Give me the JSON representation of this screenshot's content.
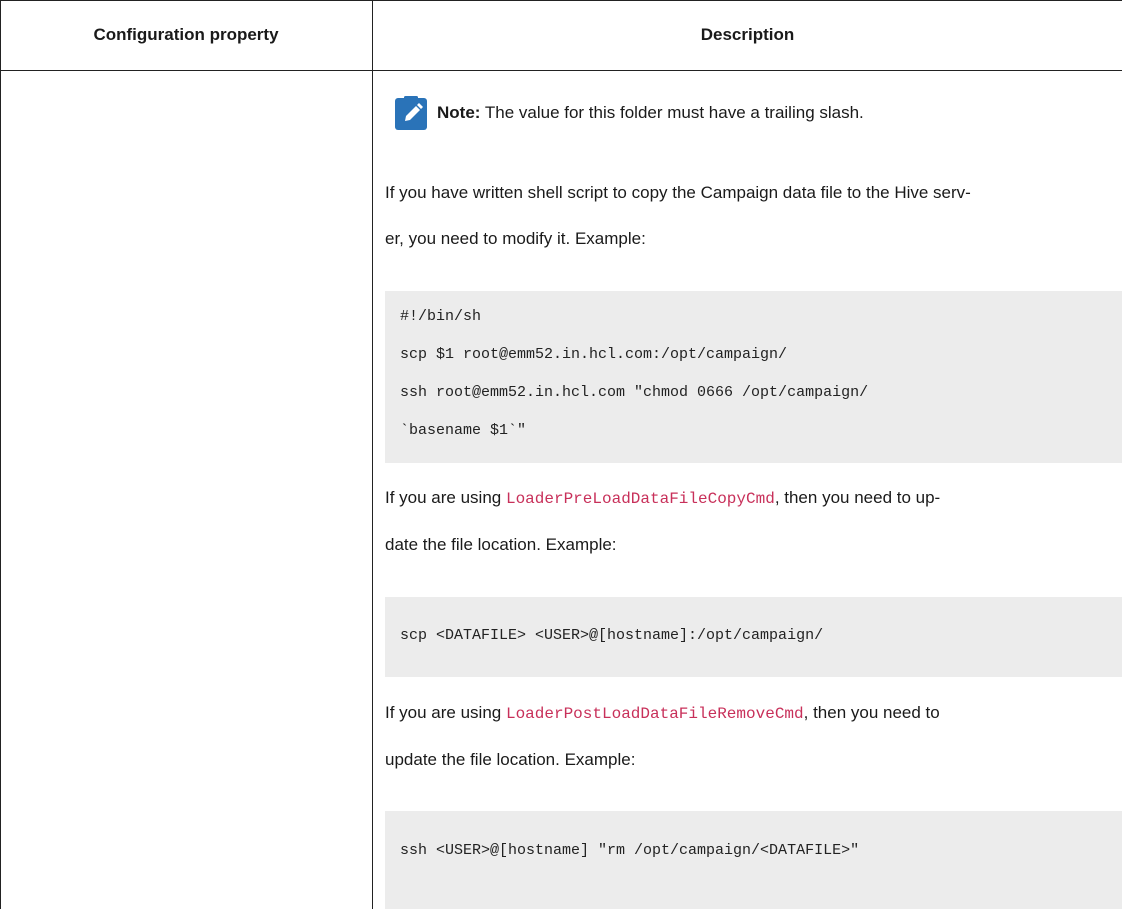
{
  "table": {
    "header": {
      "col1": "Configuration property",
      "col2": "Description"
    }
  },
  "note": {
    "icon": "pencil-note-icon",
    "label": "Note:",
    "text": " The value for this folder must have a trailing slash."
  },
  "paragraphs": {
    "p1_line1": "If you have written shell script to copy the Campaign data file to the Hive serv-",
    "p1_line2": "er, you need to modify it. Example:",
    "p2_pre": "If you are using ",
    "p2_code": "LoaderPreLoadDataFileCopyCmd",
    "p2_post": ", then you need to up-",
    "p2_line2": "date the file location. Example:",
    "p3_pre": "If you are using ",
    "p3_code": "LoaderPostLoadDataFileRemoveCmd",
    "p3_post": ", then you need to",
    "p3_line2": "update the file location. Example:"
  },
  "code_blocks": {
    "block1": [
      "#!/bin/sh",
      "scp $1 root@emm52.in.hcl.com:/opt/campaign/",
      "ssh root@emm52.in.hcl.com \"chmod 0666 /opt/campaign/",
      "`basename $1`\""
    ],
    "block2": [
      "scp <DATAFILE> <USER>@[hostname]:/opt/campaign/"
    ],
    "block3": [
      "ssh <USER>@[hostname] \"rm /opt/campaign/<DATAFILE>\""
    ]
  },
  "colors": {
    "code_link": "#c8305a",
    "code_bg": "#ececec",
    "note_icon": "#2a73b8"
  }
}
